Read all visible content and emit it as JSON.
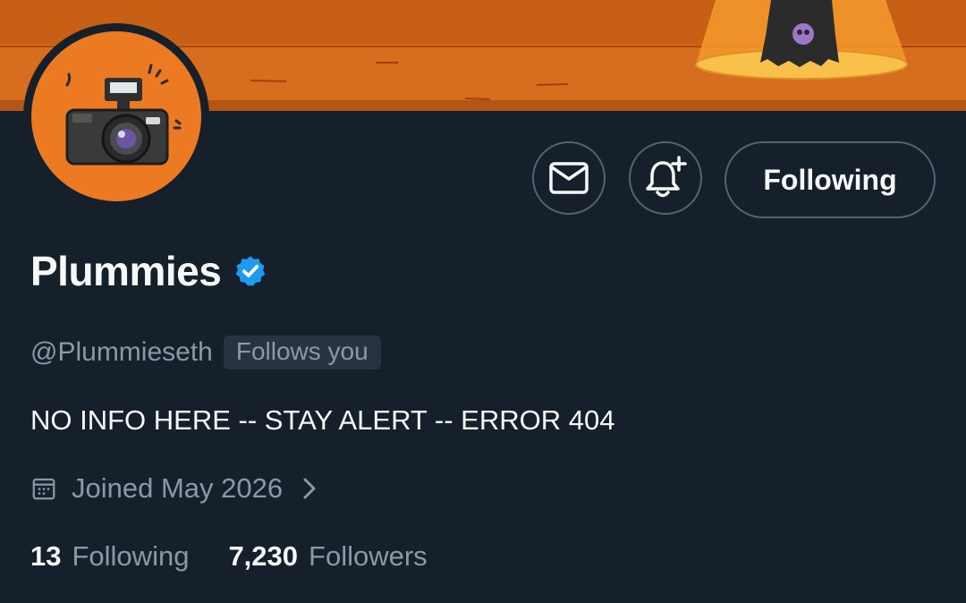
{
  "profile": {
    "display_name": "Plummies",
    "handle": "@Plummieseth",
    "follows_you_badge": "Follows you",
    "bio": "NO INFO HERE -- STAY ALERT -- ERROR 404",
    "joined": "Joined May 2026"
  },
  "actions": {
    "following_label": "Following",
    "message_icon": "envelope-icon",
    "notify_icon": "bell-plus-icon"
  },
  "stats": {
    "following_count": "13",
    "following_label": "Following",
    "followers_count": "7,230",
    "followers_label": "Followers"
  },
  "colors": {
    "background": "#15202b",
    "banner_orange": "#d8701c",
    "verified_blue": "#1d9bf0",
    "muted_text": "#8b98a5",
    "border": "#536471"
  }
}
